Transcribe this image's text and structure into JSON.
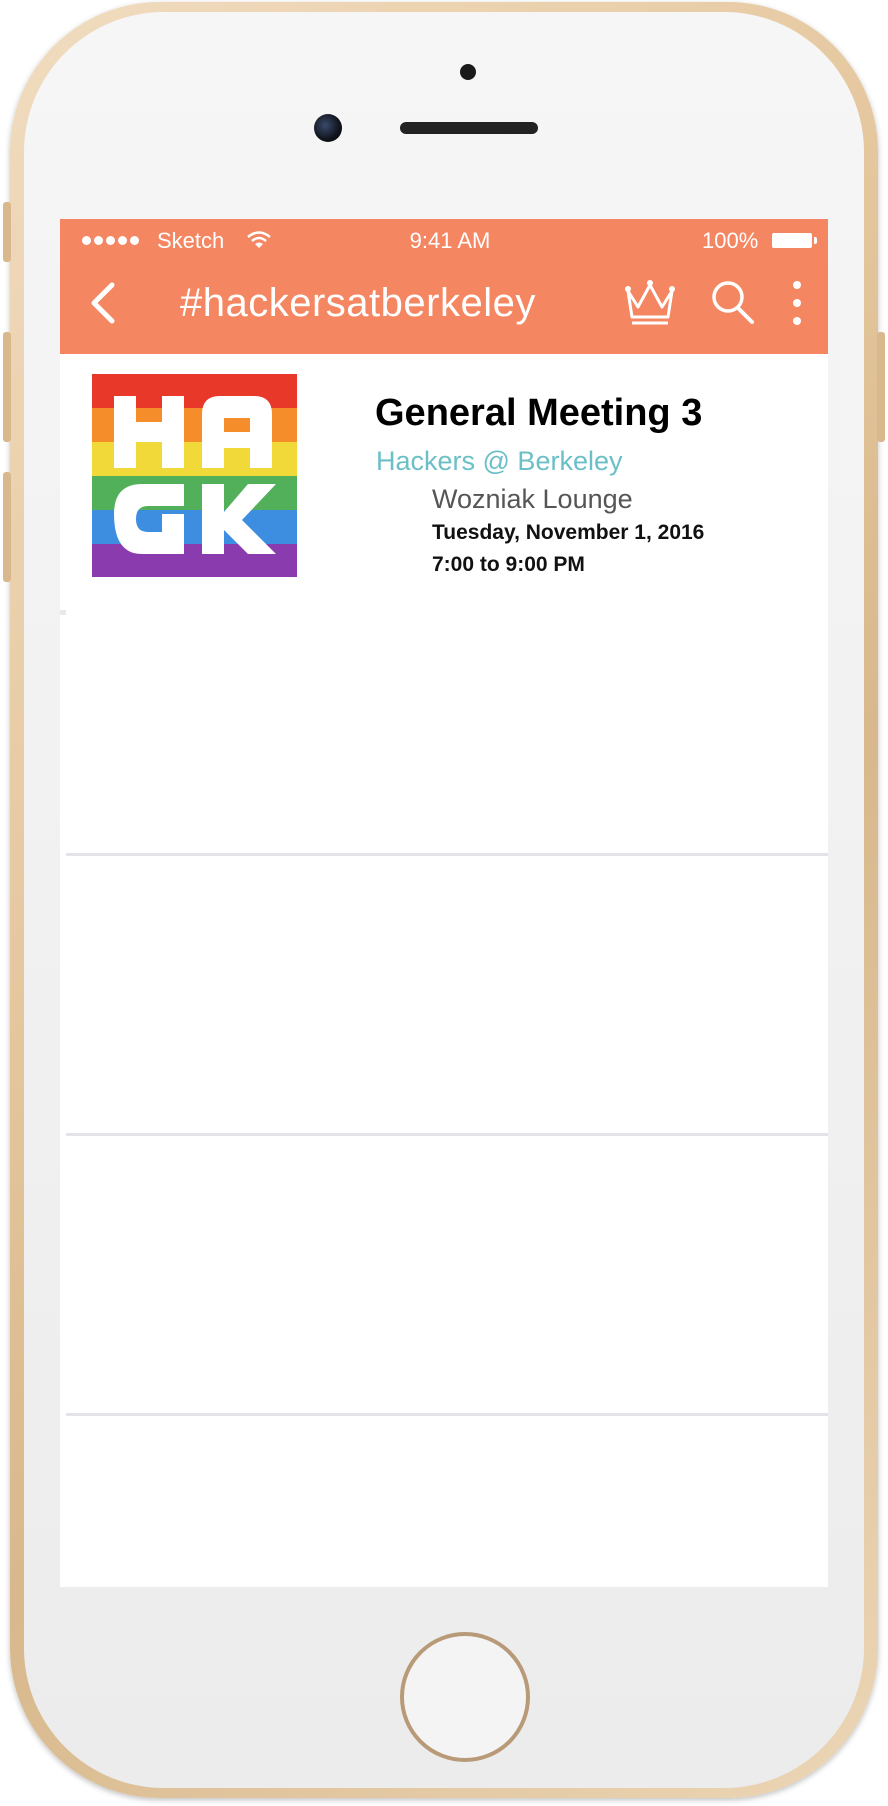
{
  "status_bar": {
    "carrier": "Sketch",
    "time": "9:41 AM",
    "battery": "100%"
  },
  "nav": {
    "title": "#hackersatberkeley",
    "icons": [
      "chevron-left-icon",
      "crown-icon",
      "search-icon",
      "more-vertical-icon"
    ]
  },
  "events": [
    {
      "thumbnail_text": "HACK",
      "title": "General Meeting 3",
      "organizer": "Hackers @ Berkeley",
      "location": "Wozniak Lounge",
      "date": "Tuesday, November 1, 2016",
      "time": "7:00 to 9:00 PM"
    }
  ],
  "colors": {
    "accent": "#f48661",
    "organizer": "#6bbfc7",
    "rainbow": [
      "#e8382a",
      "#f48d2a",
      "#f2d93a",
      "#52b05a",
      "#3d8de0",
      "#8a3cae"
    ]
  }
}
